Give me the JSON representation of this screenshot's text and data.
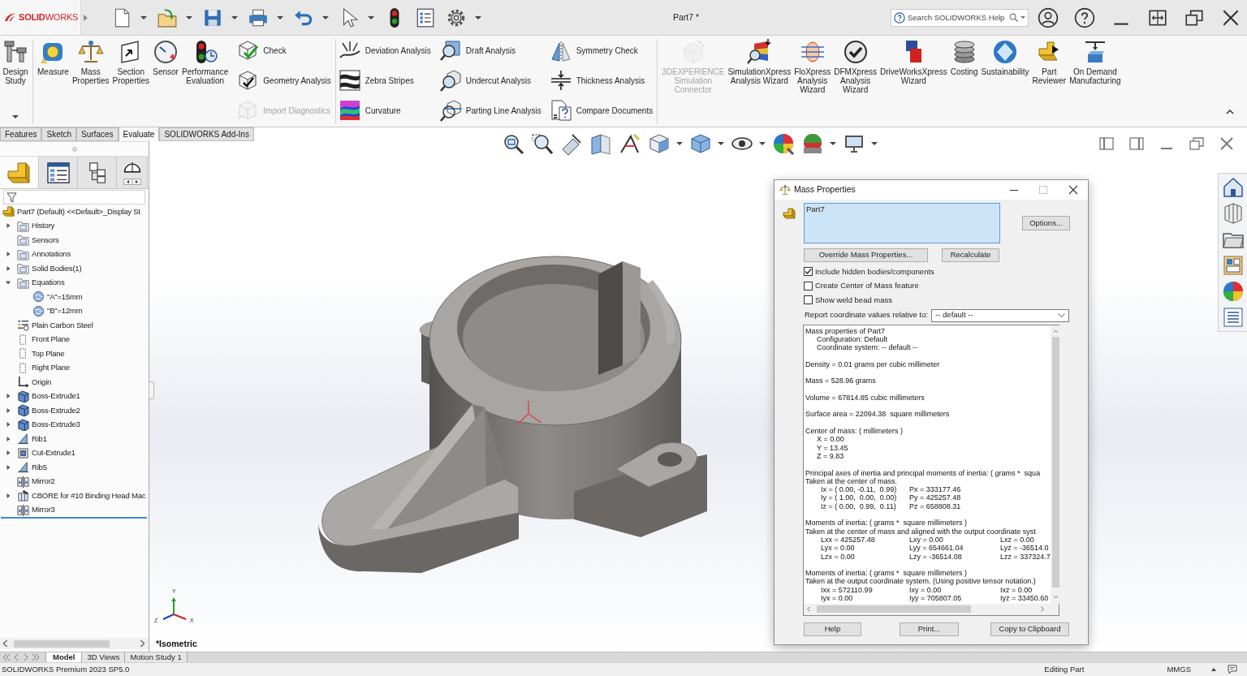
{
  "title_bar": {
    "logo_text": "**SOLID**WORKS",
    "document_title": "Part7 *",
    "search": {
      "placeholder": "Search SOLIDWORKS Help"
    }
  },
  "ribbon": {
    "sections": [
      {
        "groups": [
          {
            "kind": "large",
            "items": [
              {
                "label": "Design\nStudy",
                "disabled": false
              }
            ]
          }
        ]
      },
      {
        "groups": [
          {
            "kind": "large",
            "items": [
              {
                "label": "Measure",
                "disabled": false
              },
              {
                "label": "Mass\nProperties",
                "disabled": false
              },
              {
                "label": "Section\nProperties",
                "disabled": false
              },
              {
                "label": "Sensor",
                "disabled": false
              },
              {
                "label": "Performance\nEvaluation",
                "disabled": false
              }
            ]
          },
          {
            "kind": "stack",
            "items": [
              {
                "label": "Check",
                "disabled": false
              },
              {
                "label": "Geometry Analysis",
                "disabled": false
              },
              {
                "label": "Import Diagnostics",
                "disabled": true
              }
            ]
          }
        ]
      },
      {
        "groups": [
          {
            "kind": "stack",
            "items": [
              {
                "label": "Deviation Analysis",
                "disabled": false
              },
              {
                "label": "Zebra Stripes",
                "disabled": false
              },
              {
                "label": "Curvature",
                "disabled": false
              }
            ]
          },
          {
            "kind": "stack",
            "items": [
              {
                "label": "Draft Analysis",
                "disabled": false
              },
              {
                "label": "Undercut Analysis",
                "disabled": false
              },
              {
                "label": "Parting Line Analysis",
                "disabled": false
              }
            ]
          },
          {
            "kind": "stack",
            "items": [
              {
                "label": "Symmetry Check",
                "disabled": false
              },
              {
                "label": "Thickness Analysis",
                "disabled": false
              },
              {
                "label": "Compare Documents",
                "disabled": false
              }
            ]
          }
        ]
      },
      {
        "groups": [
          {
            "kind": "large",
            "items": [
              {
                "label": "3DEXPERIENCE\nSimulation\nConnector",
                "disabled": true
              },
              {
                "label": "SimulationXpress\nAnalysis Wizard",
                "disabled": false
              },
              {
                "label": "FloXpress\nAnalysis\nWizard",
                "disabled": false
              },
              {
                "label": "DFMXpress\nAnalysis\nWizard",
                "disabled": false
              },
              {
                "label": "DriveWorksXpress\nWizard",
                "disabled": false
              },
              {
                "label": "Costing",
                "disabled": false
              },
              {
                "label": "Sustainability",
                "disabled": false
              },
              {
                "label": "Part\nReviewer",
                "disabled": false
              },
              {
                "label": "On Demand\nManufacturing",
                "disabled": false
              }
            ]
          }
        ]
      }
    ]
  },
  "command_tabs": [
    {
      "label": "Features",
      "selected": false
    },
    {
      "label": "Sketch",
      "selected": false
    },
    {
      "label": "Surfaces",
      "selected": false
    },
    {
      "label": "Evaluate",
      "selected": true
    },
    {
      "label": "SOLIDWORKS Add-Ins",
      "selected": false
    }
  ],
  "feature_manager": {
    "panel_tabs": [
      {
        "selected": true
      },
      {
        "selected": false
      },
      {
        "selected": false
      },
      {
        "selected": false
      }
    ],
    "tree": [
      {
        "label": "Part7 (Default) <<Default>_Display St",
        "kind": "part",
        "children": [
          {
            "label": "History",
            "kind": "folder",
            "expanded": false
          },
          {
            "label": "Sensors",
            "kind": "folder"
          },
          {
            "label": "Annotations",
            "kind": "folder",
            "expanded": false
          },
          {
            "label": "Solid Bodies(1)",
            "kind": "folder",
            "expanded": false
          },
          {
            "label": "Equations",
            "kind": "folder",
            "expanded": true,
            "children": [
              {
                "label": "\"A\"=15mm",
                "kind": "equation"
              },
              {
                "label": "\"B\"=12mm",
                "kind": "equation"
              }
            ]
          },
          {
            "label": "Plain Carbon Steel",
            "kind": "material"
          },
          {
            "label": "Front Plane",
            "kind": "plane"
          },
          {
            "label": "Top Plane",
            "kind": "plane"
          },
          {
            "label": "Right Plane",
            "kind": "plane"
          },
          {
            "label": "Origin",
            "kind": "origin"
          },
          {
            "label": "Boss-Extrude1",
            "kind": "extrude",
            "expanded": false
          },
          {
            "label": "Boss-Extrude2",
            "kind": "extrude",
            "expanded": false
          },
          {
            "label": "Boss-Extrude3",
            "kind": "extrude",
            "expanded": false
          },
          {
            "label": "Rib1",
            "kind": "rib",
            "expanded": false
          },
          {
            "label": "Cut-Extrude1",
            "kind": "cut",
            "expanded": false
          },
          {
            "label": "Rib5",
            "kind": "rib",
            "expanded": false
          },
          {
            "label": "Mirror2",
            "kind": "mirror"
          },
          {
            "label": "CBORE for #10 Binding Head Mac",
            "kind": "hole",
            "expanded": false
          },
          {
            "label": "Mirror3",
            "kind": "mirror"
          }
        ]
      }
    ]
  },
  "viewport": {
    "triad": {
      "y_label": "Y",
      "x_label": "X",
      "z_label": "Z"
    },
    "view_name": "*Isometric"
  },
  "mass_properties": {
    "title": "Mass Properties",
    "selection": [
      "Part7"
    ],
    "options_button": "Options...",
    "override_button": "Override Mass Properties...",
    "recalculate_button": "Recalculate",
    "checkboxes": [
      {
        "label": "Include hidden bodies/components",
        "checked": true
      },
      {
        "label": "Create Center of Mass feature",
        "checked": false
      },
      {
        "label": "Show weld bead mass",
        "checked": false
      }
    ],
    "coordinate_label": "Report coordinate values relative to:",
    "coordinate_select": {
      "value": "-- default --"
    },
    "report": {
      "sections": [
        {
          "lines": [
            {
              "kind": "heading",
              "text": "Mass properties of Part7"
            },
            {
              "kind": "detail",
              "text": "Configuration: Default"
            },
            {
              "kind": "detail",
              "text": "Coordinate system: -- default --"
            }
          ]
        },
        {
          "lines": [
            {
              "kind": "heading",
              "text": "Density = 0.01 grams per cubic millimeter"
            }
          ]
        },
        {
          "lines": [
            {
              "kind": "heading",
              "text": "Mass = 528.96 grams"
            }
          ]
        },
        {
          "lines": [
            {
              "kind": "heading",
              "text": "Volume = 67814.85 cubic millimeters"
            }
          ]
        },
        {
          "lines": [
            {
              "kind": "heading",
              "text": "Surface area = 22094.38  square millimeters"
            }
          ]
        },
        {
          "lines": [
            {
              "kind": "heading",
              "text": "Center of mass: ( millimeters )"
            },
            {
              "kind": "detail",
              "text": "X = 0.00"
            },
            {
              "kind": "detail",
              "text": "Y = 13.45"
            },
            {
              "kind": "detail",
              "text": "Z = 9.83"
            }
          ]
        },
        {
          "lines": [
            {
              "kind": "heading",
              "text": "Principal axes of inertia and principal moments of inertia: ( grams *  squa"
            },
            {
              "kind": "heading",
              "text": "Taken at the center of mass."
            },
            {
              "kind": "columns",
              "cells": [
                "Ix = ( 0.00, -0.11,  0.99)",
                "Px = 333177.46"
              ]
            },
            {
              "kind": "columns",
              "cells": [
                "Iy = ( 1.00,  0.00,  0.00)",
                "Py = 425257.48"
              ]
            },
            {
              "kind": "columns",
              "cells": [
                "Iz = ( 0.00,  0.99,  0.11)",
                "Pz = 658808.31"
              ]
            }
          ]
        },
        {
          "lines": [
            {
              "kind": "heading",
              "text": "Moments of inertia: ( grams *  square millimeters )"
            },
            {
              "kind": "heading",
              "text": "Taken at the center of mass and aligned with the output coordinate syst"
            },
            {
              "kind": "columns",
              "cells": [
                "Lxx = 425257.48",
                "Lxy = 0.00",
                "Lxz = 0.00"
              ]
            },
            {
              "kind": "columns",
              "cells": [
                "Lyx = 0.00",
                "Lyy = 654661.04",
                "Lyz = -36514.0"
              ]
            },
            {
              "kind": "columns",
              "cells": [
                "Lzx = 0.00",
                "Lzy = -36514.08",
                "Lzz = 337324.7"
              ]
            }
          ]
        },
        {
          "lines": [
            {
              "kind": "heading",
              "text": "Moments of inertia: ( grams *  square millimeters )"
            },
            {
              "kind": "heading",
              "text": "Taken at the output coordinate system. (Using positive tensor notation.)"
            },
            {
              "kind": "columns",
              "cells": [
                "Ixx = 572110.99",
                "Ixy = 0.00",
                "Ixz = 0.00"
              ]
            },
            {
              "kind": "columns",
              "cells": [
                "Iyx = 0.00",
                "Iyy = 705807.05",
                "Iyz = 33450.60"
              ]
            }
          ]
        }
      ]
    },
    "footer_buttons": [
      "Help",
      "Print...",
      "Copy to Clipboard"
    ]
  },
  "bottom_tabs": [
    {
      "label": "Model",
      "selected": true
    },
    {
      "label": "3D Views",
      "selected": false
    },
    {
      "label": "Motion Study 1",
      "selected": false
    }
  ],
  "status_bar": {
    "product": "SOLIDWORKS Premium 2023 SP5.0",
    "mode": "Editing Part",
    "units": "MMGS"
  }
}
